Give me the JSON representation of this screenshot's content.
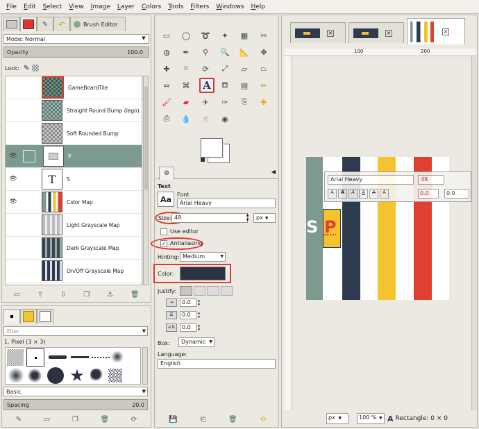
{
  "menu": [
    "File",
    "Edit",
    "Select",
    "View",
    "Image",
    "Layer",
    "Colors",
    "Tools",
    "Filters",
    "Windows",
    "Help"
  ],
  "layers_panel": {
    "tab_label": "Brush Editor",
    "mode_label": "Mode: Normal",
    "opacity_label": "Opacity",
    "opacity_value": "100.0",
    "lock_label": "Lock:",
    "layers": [
      {
        "name": "GameBoardTile",
        "visible": false
      },
      {
        "name": "Straight Round Bump (lego)",
        "visible": false
      },
      {
        "name": "Soft Rounded Bump",
        "visible": false
      },
      {
        "name": "P",
        "visible": true,
        "selected": true
      },
      {
        "name": "S",
        "visible": true
      },
      {
        "name": "Color Map",
        "visible": true
      },
      {
        "name": "Light Grayscale Map",
        "visible": false
      },
      {
        "name": "Dark Grayscale Map",
        "visible": false
      },
      {
        "name": "On/Off Grayscale Map",
        "visible": false
      }
    ]
  },
  "brushes_panel": {
    "filter_placeholder": "filter",
    "brush_name": "1. Pixel (3 × 3)",
    "preset": "Basic.",
    "spacing_label": "Spacing",
    "spacing_value": "20.0"
  },
  "toolbox": {
    "fg_color": "#2e3140",
    "bg_color": "#ffffff"
  },
  "text_options": {
    "header": "Text",
    "font_label": "Font",
    "font_value": "Arial Heavy",
    "font_glyph": "Aa",
    "size_label": "Size:",
    "size_value": "48",
    "unit": "px",
    "use_editor_label": "Use editor",
    "use_editor_checked": false,
    "antialiasing_label": "Antialiasing",
    "antialiasing_checked": true,
    "hinting_label": "Hinting:",
    "hinting_value": "Medium",
    "color_label": "Color:",
    "color_value": "#2e3140",
    "justify_label": "Justify:",
    "indent_value": "0.0",
    "line_spacing_value": "0.0",
    "letter_spacing_value": "0.0",
    "box_label": "Box:",
    "box_value": "Dynamic",
    "language_label": "Language:",
    "language_value": "English"
  },
  "image_window": {
    "ruler_marks": [
      "100",
      "200"
    ],
    "text_toolbar": {
      "font": "Arial Heavy",
      "size": "48",
      "baseline": "0.0",
      "kerning": "0.0"
    },
    "canvas_text": "SP",
    "status": {
      "unit": "px",
      "zoom": "100 %",
      "message": "Rectangle: 0 × 0"
    },
    "colors": {
      "sage": "#7c9a8f",
      "navy": "#2e3a4d",
      "yellow": "#f4c430",
      "red": "#e04030"
    }
  }
}
